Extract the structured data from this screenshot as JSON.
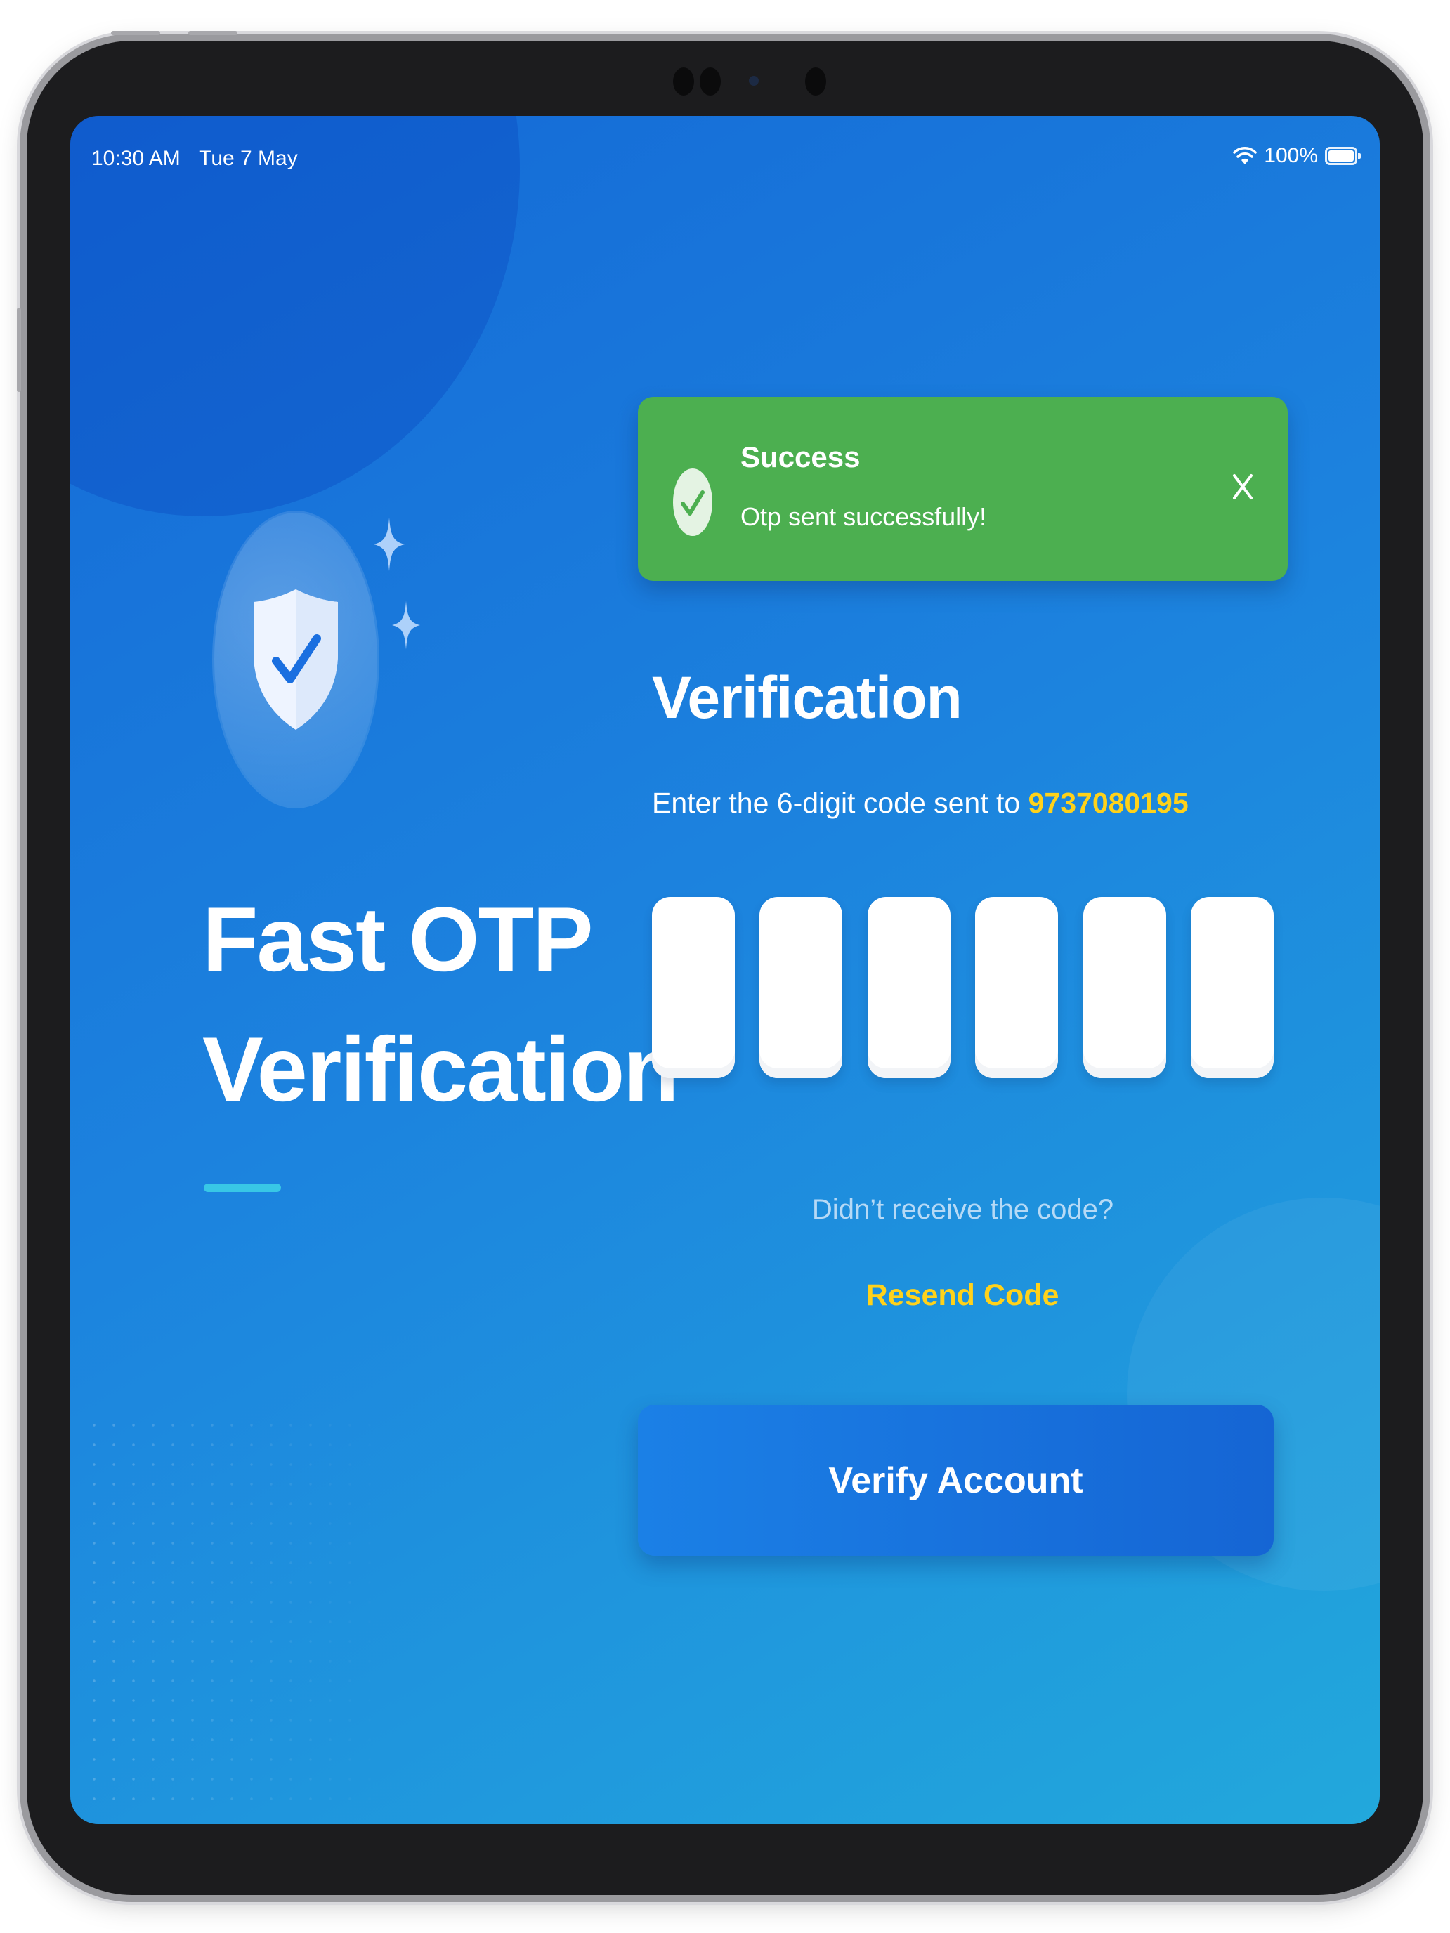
{
  "status_bar": {
    "time": "10:30 AM",
    "date": "Tue 7 May",
    "battery": "100%",
    "wifi_icon": "wifi-icon",
    "battery_icon": "battery-icon"
  },
  "hero": {
    "title_line1": "Fast OTP",
    "title_line2": "Verification",
    "icon": "shield-check-icon"
  },
  "toast": {
    "title": "Success",
    "message": "Otp sent successfully!",
    "close_label": "X",
    "color": "#4caf50"
  },
  "verification": {
    "title": "Verification",
    "subtitle": "Enter the 6-digit code sent to",
    "phone": "9737080195",
    "otp_digits": [
      "",
      "",
      "",
      "",
      "",
      ""
    ],
    "resend_prompt": "Didn’t receive the code?",
    "resend_label": "Resend Code",
    "verify_label": "Verify Account"
  },
  "colors": {
    "accent_yellow": "#ffd21a",
    "background_start": "#1468d6",
    "background_end": "#22a8dc",
    "button": "#1565d4"
  }
}
